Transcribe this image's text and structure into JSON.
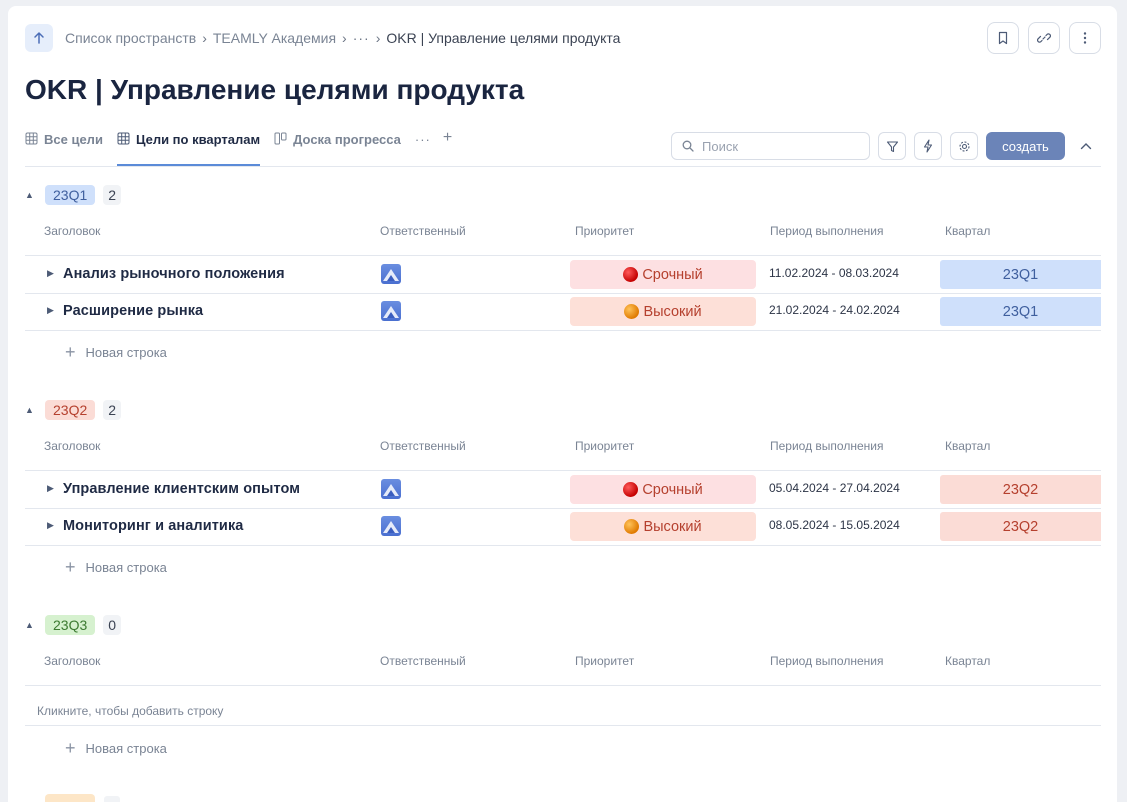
{
  "header": {
    "breadcrumb": {
      "spaces": "Список пространств",
      "academy": "TEAMLY Академия",
      "ellipsis": "···",
      "current": "OKR | Управление целями продукта"
    },
    "title": "OKR | Управление целями продукта"
  },
  "tabs": [
    {
      "label": "Все цели"
    },
    {
      "label": "Цели по кварталам"
    },
    {
      "label": "Доска прогресса"
    }
  ],
  "tabs_more": "···",
  "tabs_add": "+",
  "toolbar": {
    "search_placeholder": "Поиск",
    "create_label": "создать"
  },
  "columns": {
    "title": "Заголовок",
    "owner": "Ответственный",
    "priority": "Приоритет",
    "period": "Период выполнения",
    "quarter": "Квартал"
  },
  "new_row_label": "Новая строка",
  "empty_hint": "Кликните, чтобы добавить строку",
  "groups": [
    {
      "name": "23Q1",
      "count": "2",
      "badge_bg": "#cfe0fb",
      "badge_fg": "#3f5f9e",
      "rows": [
        {
          "title": "Анализ рыночного положения",
          "priority": "Срочный",
          "period": "11.02.2024 - 08.03.2024",
          "quarter": "23Q1"
        },
        {
          "title": "Расширение рынка",
          "priority": "Высокий",
          "period": "21.02.2024 - 24.02.2024",
          "quarter": "23Q1"
        }
      ]
    },
    {
      "name": "23Q2",
      "count": "2",
      "badge_bg": "#fbdcd6",
      "badge_fg": "#b5402e",
      "rows": [
        {
          "title": "Управление клиентским опытом",
          "priority": "Срочный",
          "period": "05.04.2024 - 27.04.2024",
          "quarter": "23Q2"
        },
        {
          "title": "Мониторинг и аналитика",
          "priority": "Высокий",
          "period": "08.05.2024 - 15.05.2024",
          "quarter": "23Q2"
        }
      ]
    },
    {
      "name": "23Q3",
      "count": "0",
      "badge_bg": "#d6f1cf",
      "badge_fg": "#3c7a31",
      "rows": []
    }
  ],
  "colors": {
    "accent": "#6b84b8",
    "urgent_bg": "#fde0e2",
    "high_bg": "#fde0d8"
  }
}
